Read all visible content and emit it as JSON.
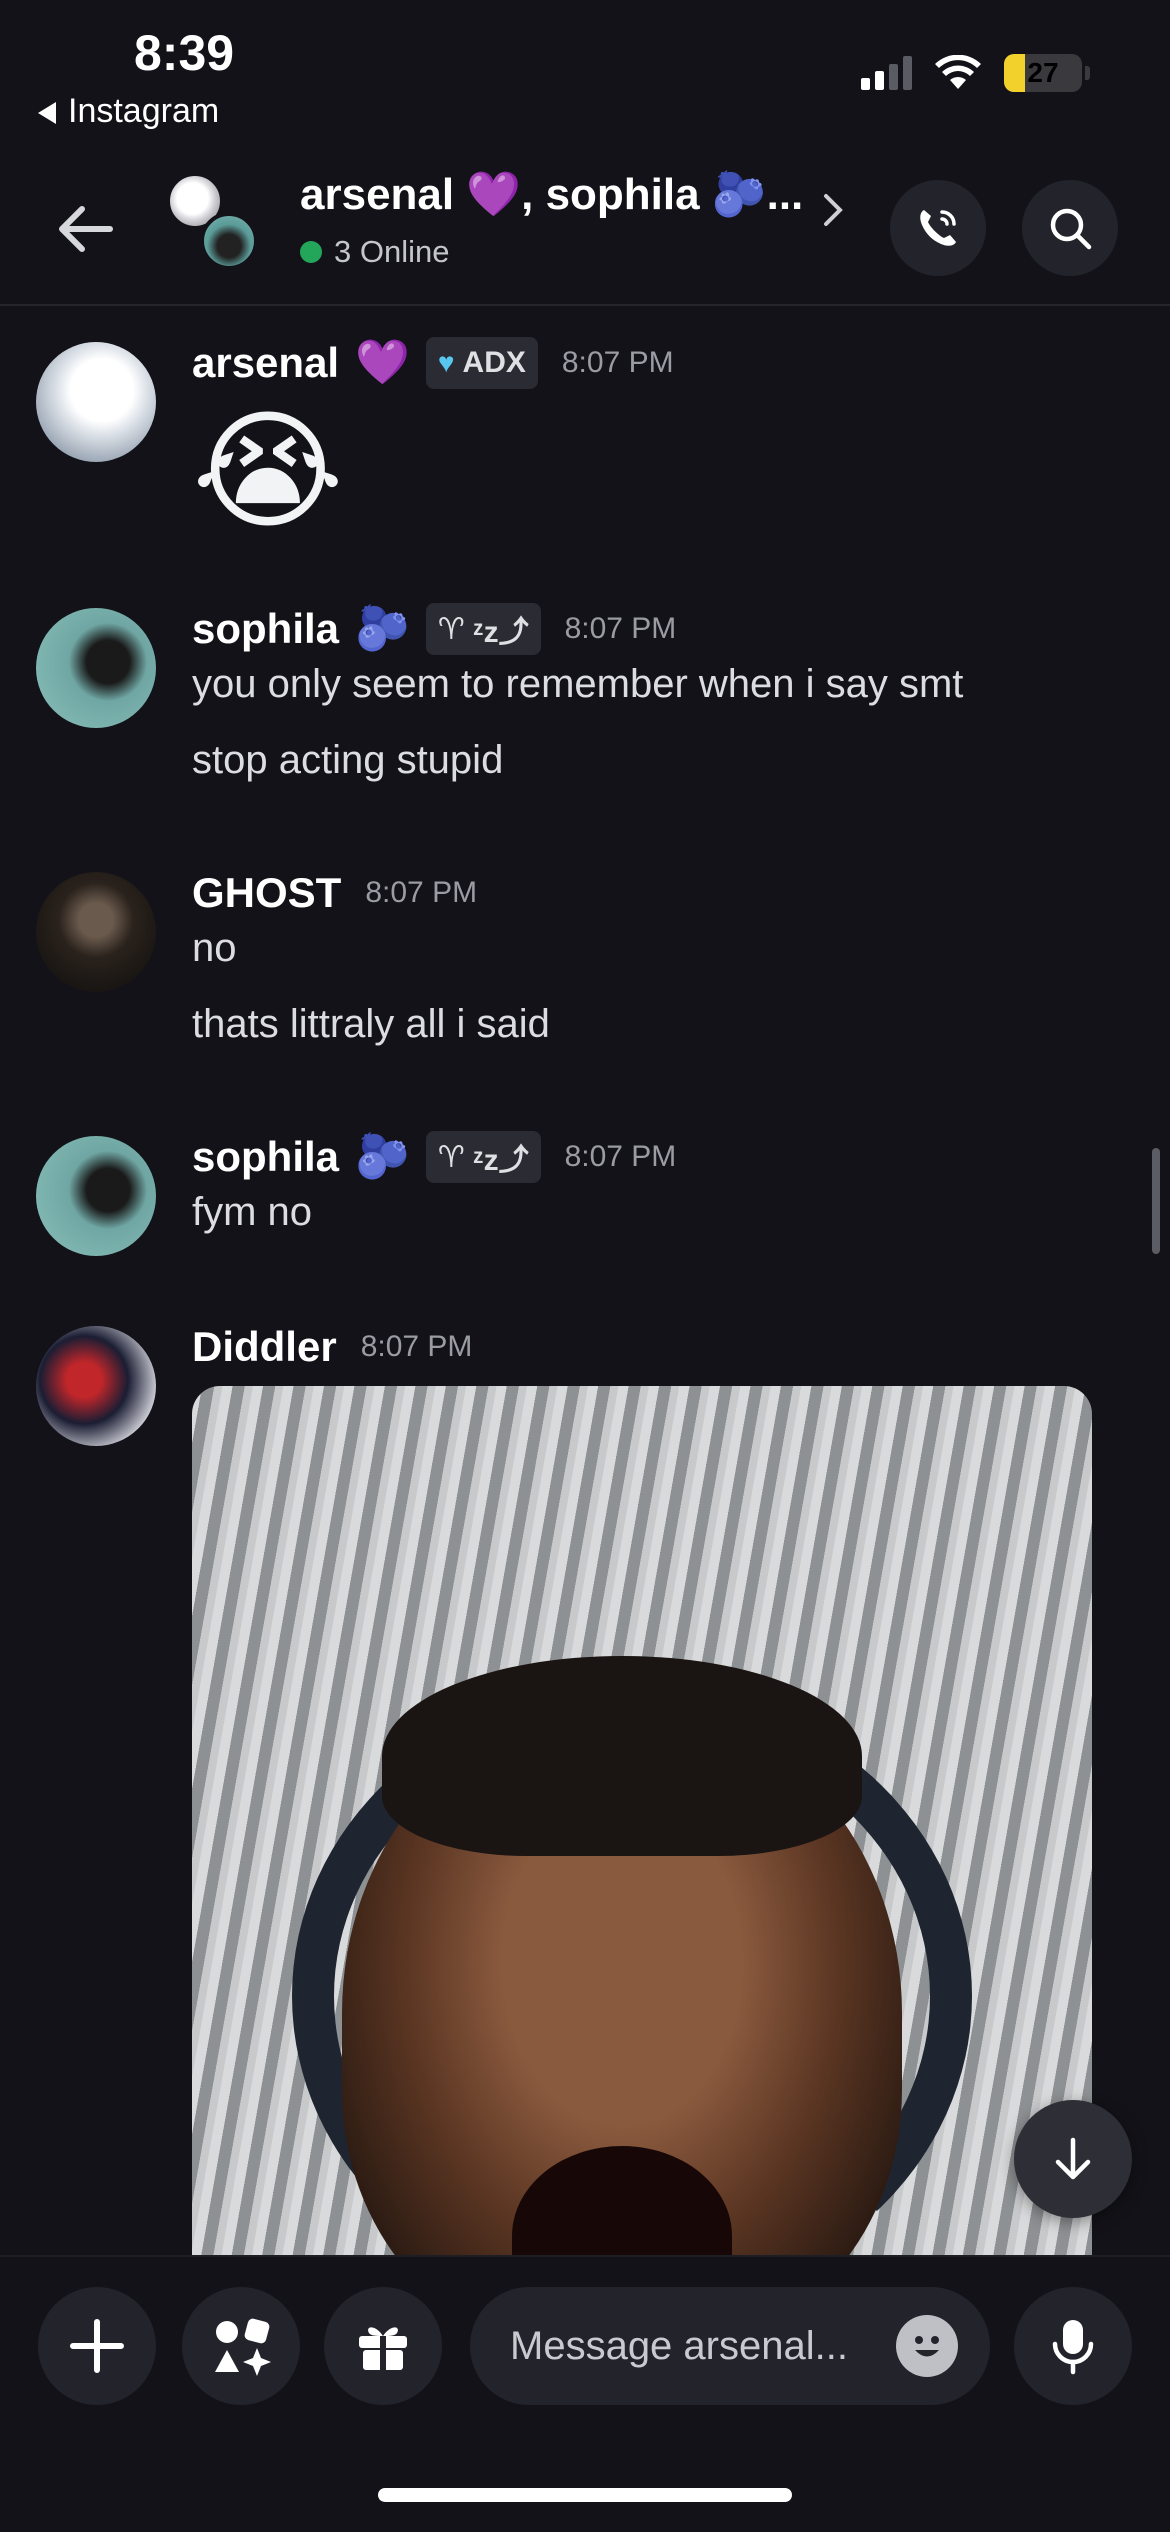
{
  "status_bar": {
    "time": "8:39",
    "back_app": "Instagram",
    "battery": "27",
    "battery_level": 0.27
  },
  "header": {
    "title": "arsenal 💜, sophila 🫐...",
    "online": "3 Online",
    "icons": {
      "back": "back-arrow-icon",
      "call": "phone-call-icon",
      "search": "search-icon",
      "chevron": "chevron-right-icon"
    }
  },
  "messages": [
    {
      "user": "arsenal",
      "user_emoji": "💜",
      "badge": "ADX",
      "time": "8:07 PM",
      "lines": [],
      "emoji": "😭"
    },
    {
      "user": "sophila",
      "user_emoji": "🫐",
      "badge": "ᶻz⤴",
      "time": "8:07 PM",
      "lines": [
        "you only seem to remember when i say smt",
        "stop acting stupid"
      ]
    },
    {
      "user": "GHOST",
      "time": "8:07 PM",
      "lines": [
        "no",
        "thats littraly all i said"
      ]
    },
    {
      "user": "sophila",
      "user_emoji": "🫐",
      "badge": "ᶻz⤴",
      "time": "8:07 PM",
      "lines": [
        "fym no"
      ]
    },
    {
      "user": "Diddler",
      "time": "8:07 PM",
      "attachment": "image"
    }
  ],
  "composer": {
    "placeholder": "Message arsenal...",
    "icons": {
      "plus": "plus-icon",
      "apps": "apps-icon",
      "gift": "gift-icon",
      "emoji": "emoji-icon",
      "mic": "microphone-icon"
    }
  },
  "colors": {
    "background": "#121218",
    "online": "#23a55a",
    "badge_bg": "#2b2c33"
  }
}
